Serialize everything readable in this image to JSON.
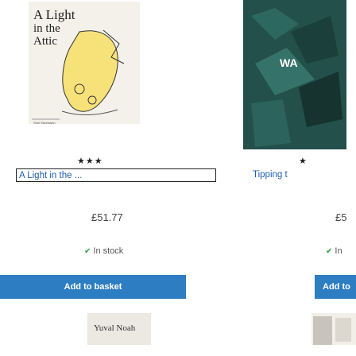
{
  "products": [
    {
      "cover": {
        "title_line1": "A Light",
        "title_line2": "in the",
        "title_line3": "Attic",
        "footer": "Shel Silverstein"
      },
      "rating": "★★★",
      "title": "A Light in the ...",
      "price": "£51.77",
      "stock": "In stock",
      "button": "Add to basket"
    },
    {
      "cover": {
        "text": "WA"
      },
      "rating": "★",
      "title": "Tipping t",
      "price": "£5",
      "stock": "In",
      "button": "Add to"
    }
  ],
  "shelf": {
    "left_label": "Yuval Noah"
  },
  "colors": {
    "link": "#1e5fb0",
    "button": "#2c7dc2",
    "in_stock_check": "#2f9e3a"
  }
}
